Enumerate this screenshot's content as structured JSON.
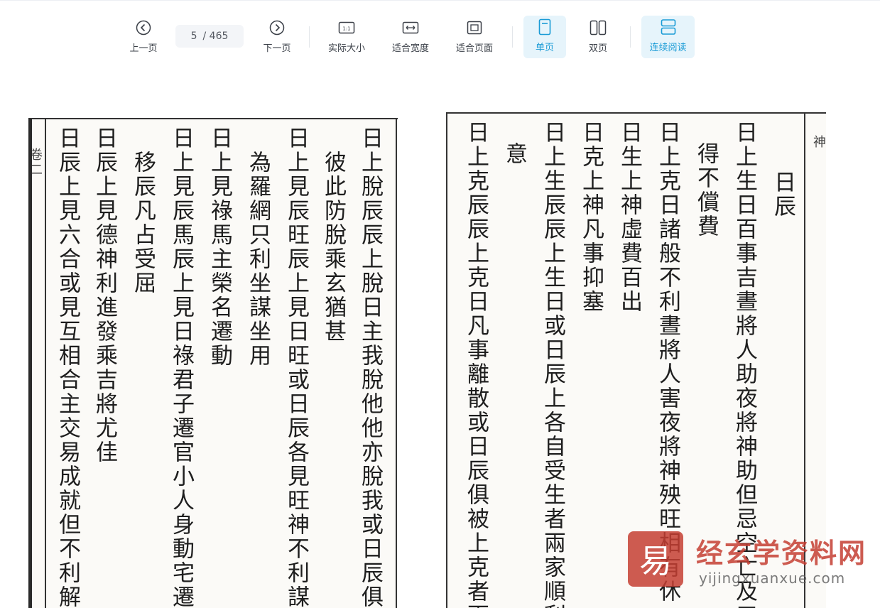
{
  "toolbar": {
    "prev_label": "上一页",
    "next_label": "下一页",
    "current_page": "5",
    "total_pages": "/ 465",
    "actual_size_label": "实际大小",
    "fit_width_label": "适合宽度",
    "fit_page_label": "适合页面",
    "single_page_label": "单页",
    "double_page_label": "双页",
    "continuous_label": "连续阅读",
    "actual_size_icon_text": "1:1",
    "active_color": "#1a9bd6"
  },
  "left_page": {
    "columns": [
      "日上脫辰辰上脫日主我脫他他亦脫我或日辰俱被",
      "彼此防脫乘玄猶甚",
      "日上見辰旺辰上見日旺或日辰各見旺神不利謀動",
      "為羅網只利坐謀坐用",
      "日上見祿馬主榮名遷動",
      "日上見辰馬辰上見日祿君子遷官小人身動宅遷右",
      "移辰凡占受屈",
      "日辰上見德神利進發乘吉將尤佳",
      "日辰上見六合或見互相合主交易成就但不利解散"
    ],
    "margin_text": "卷二"
  },
  "right_page": {
    "columns": [
      "日辰",
      "日上生日百事吉晝將人助夜將神助但忌空亡及三",
      "得不償費",
      "日上克日諸般不利晝將人害夜將神殃旺相有休",
      "日生上神虛費百出",
      "日克上神凡事抑塞",
      "日上生辰辰上生日或日辰上各自受生者兩家順利",
      "意",
      "日上克辰辰上克日凡事離散或日辰俱被上克者兩"
    ],
    "margin_text": "神"
  },
  "watermark": {
    "logo_glyph": "易",
    "title": "经玄学资料网",
    "url": "yijingxuanxue.com"
  }
}
